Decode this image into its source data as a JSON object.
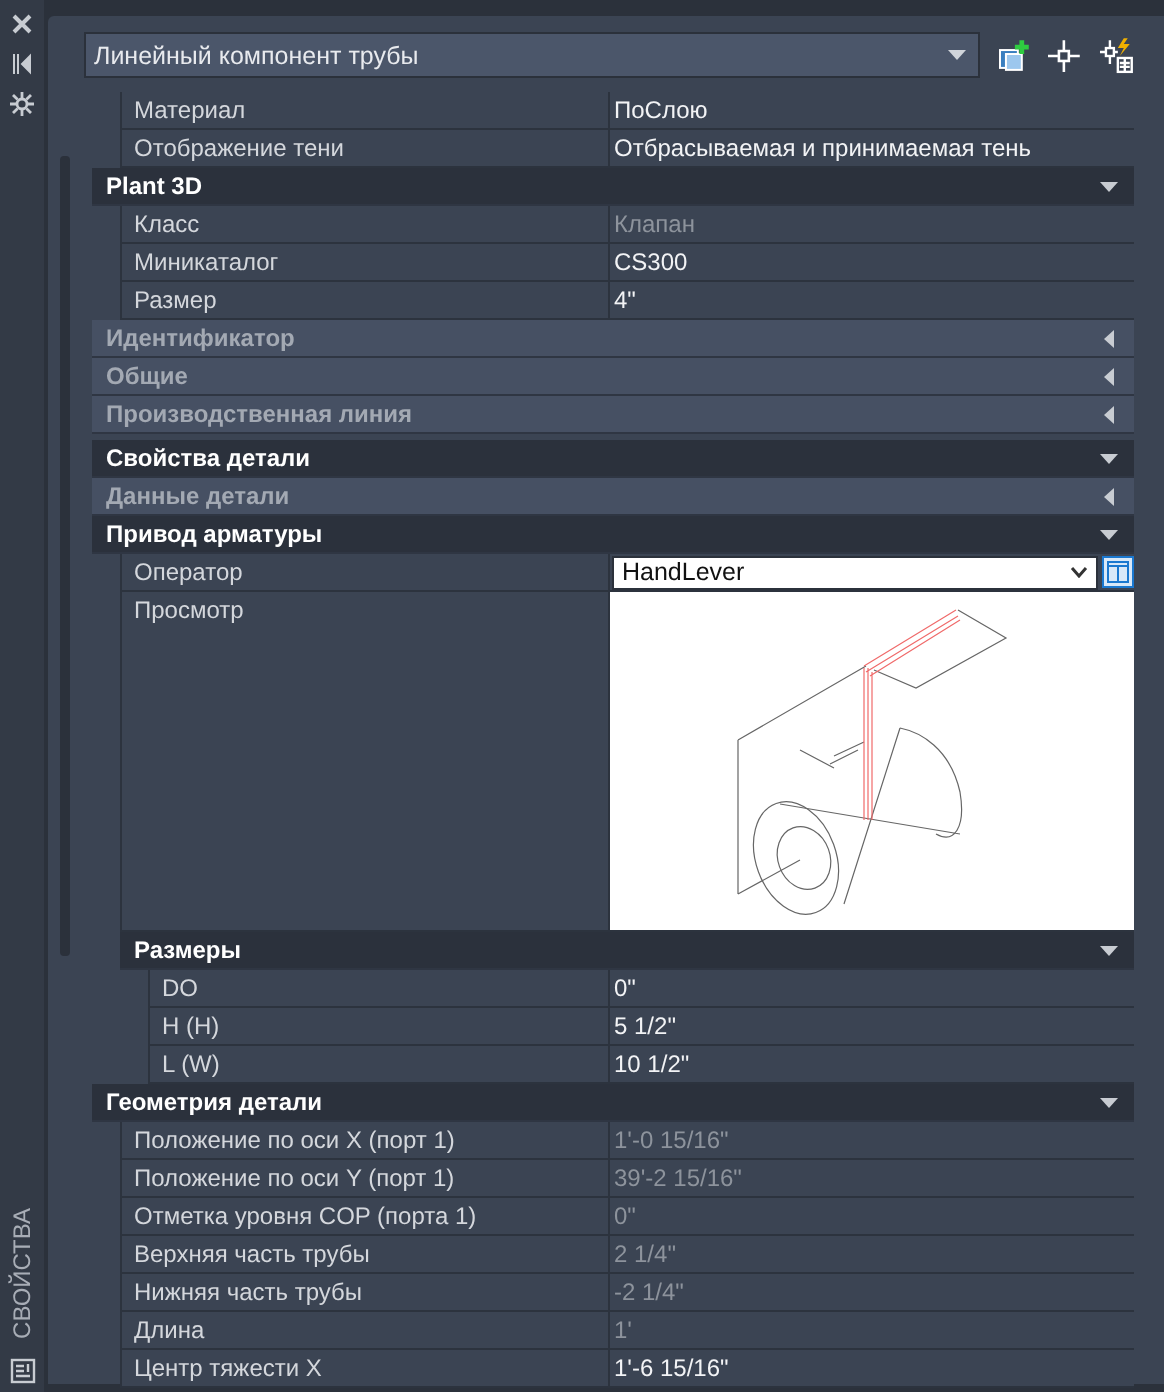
{
  "side_title": "СВОЙСТВА",
  "selector": {
    "value": "Линейный компонент трубы"
  },
  "sections": [
    {
      "items": [
        {
          "kind": "property",
          "label": "Материал",
          "value": "ПоСлою",
          "disabled": false
        },
        {
          "kind": "property",
          "label": "Отображение тени",
          "value": "Отбрасываемая и принимаемая тень",
          "disabled": false
        },
        {
          "kind": "group",
          "title": "Plant 3D",
          "expanded": true,
          "children": [
            {
              "kind": "property",
              "label": "Класс",
              "value": "Клапан",
              "disabled": true
            },
            {
              "kind": "property",
              "label": "Миникаталог",
              "value": "CS300",
              "disabled": false
            },
            {
              "kind": "property",
              "label": "Размер",
              "value": "4\"",
              "disabled": false
            }
          ]
        },
        {
          "kind": "group",
          "title": "Идентификатор",
          "expanded": false
        },
        {
          "kind": "group",
          "title": "Общие",
          "expanded": false
        },
        {
          "kind": "group",
          "title": "Производственная линия",
          "expanded": false
        }
      ]
    },
    {
      "items": [
        {
          "kind": "group",
          "title": "Свойства детали",
          "expanded": true
        },
        {
          "kind": "group",
          "title": "Данные детали",
          "expanded": false
        },
        {
          "kind": "group",
          "title": "Привод арматуры",
          "expanded": true,
          "children": [
            {
              "kind": "dropdown",
              "label": "Оператор",
              "value": "HandLever"
            },
            {
              "kind": "preview",
              "label": "Просмотр"
            },
            {
              "kind": "group",
              "title": "Размеры",
              "expanded": true,
              "children": [
                {
                  "kind": "property",
                  "label": "DO",
                  "value": "0\"",
                  "disabled": false
                },
                {
                  "kind": "property",
                  "label": "H (H)",
                  "value": "5 1/2\"",
                  "disabled": false
                },
                {
                  "kind": "property",
                  "label": "L (W)",
                  "value": "10 1/2\"",
                  "disabled": false
                }
              ]
            }
          ]
        },
        {
          "kind": "group",
          "title": "Геометрия детали",
          "expanded": true,
          "children": [
            {
              "kind": "property",
              "label": "Положение по оси X (порт 1)",
              "value": "1'-0 15/16\"",
              "disabled": true
            },
            {
              "kind": "property",
              "label": "Положение по оси Y (порт 1)",
              "value": "39'-2 15/16\"",
              "disabled": true
            },
            {
              "kind": "property",
              "label": "Отметка уровня COP (порта 1)",
              "value": "0\"",
              "disabled": true
            },
            {
              "kind": "property",
              "label": "Верхняя часть трубы",
              "value": "2 1/4\"",
              "disabled": true
            },
            {
              "kind": "property",
              "label": "Нижняя часть трубы",
              "value": "-2 1/4\"",
              "disabled": true
            },
            {
              "kind": "property",
              "label": "Длина",
              "value": "1'",
              "disabled": true
            },
            {
              "kind": "property",
              "label": "Центр тяжести X",
              "value": "1'-6 15/16\"",
              "disabled": false
            }
          ]
        }
      ]
    }
  ]
}
